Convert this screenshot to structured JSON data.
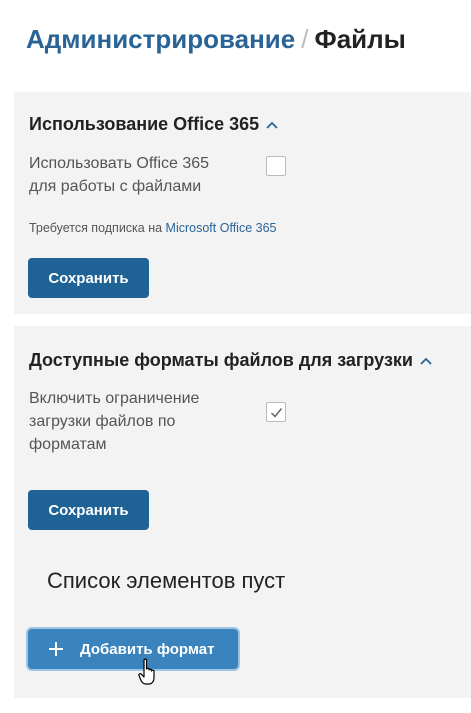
{
  "breadcrumb": {
    "parent": "Администрирование",
    "separator": "/",
    "current": "Файлы"
  },
  "office365": {
    "title": "Использование Office 365",
    "field_label_line1": "Использовать Office 365",
    "field_label_line2": "для работы с файлами",
    "checked": false,
    "hint_prefix": "Требуется подписка на ",
    "hint_link": "Microsoft Office 365",
    "save_label": "Сохранить"
  },
  "formats": {
    "title": "Доступные форматы файлов для загрузки",
    "field_label_line1": "Включить ограничение",
    "field_label_line2": "загрузки файлов по",
    "field_label_line3": "форматам",
    "checked": true,
    "save_label": "Сохранить",
    "empty_text": "Список элементов пуст",
    "add_label": "Добавить формат"
  },
  "colors": {
    "link": "#2a6496",
    "primary_button": "#1f6296",
    "add_button": "#3a83bd",
    "panel_bg": "#f3f3f3"
  },
  "icons": {
    "chevron": "chevron-up-icon",
    "check": "checkmark-icon",
    "plus": "plus-icon",
    "cursor": "hand-pointer-cursor-icon"
  }
}
